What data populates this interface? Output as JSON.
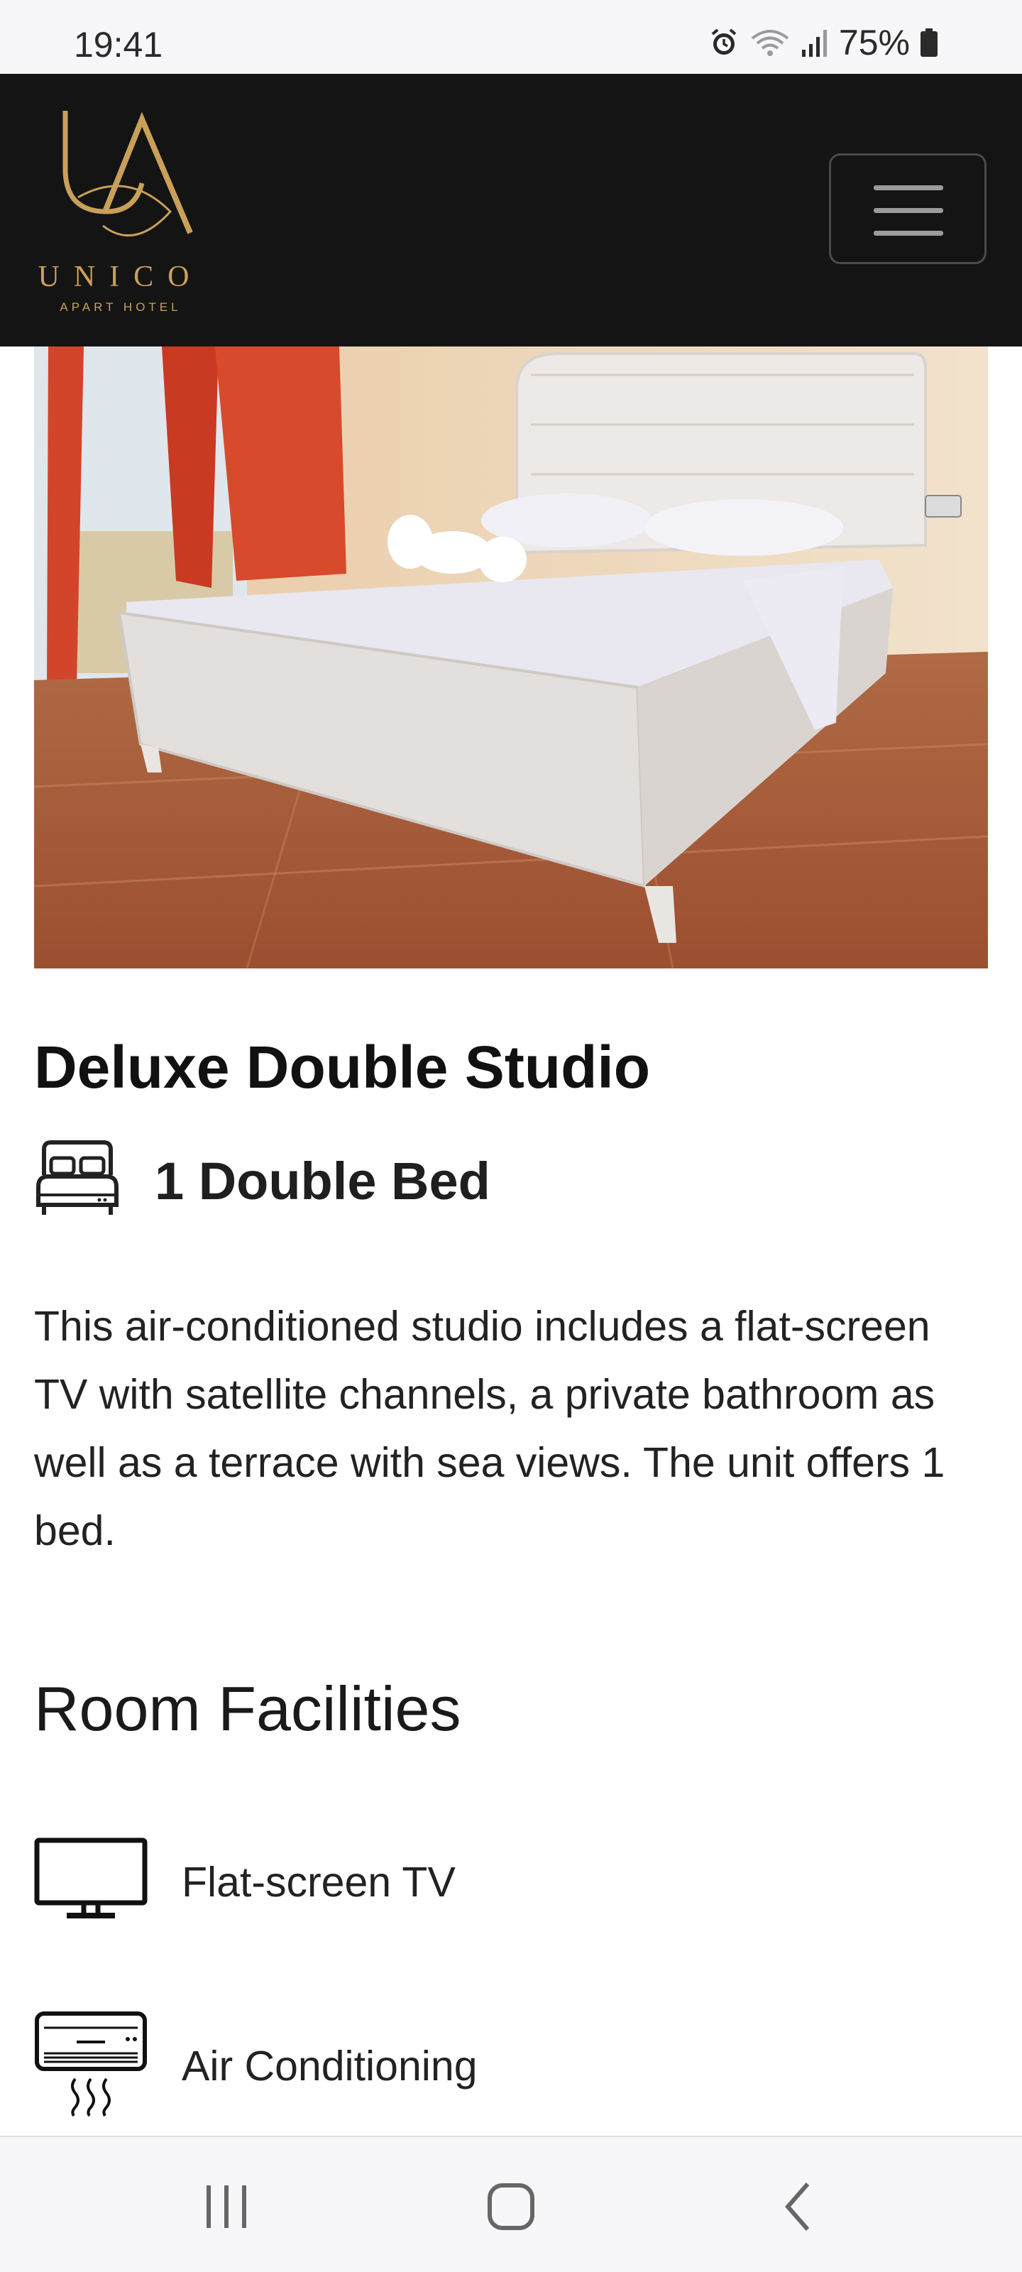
{
  "status_bar": {
    "time": "19:41",
    "battery_percent": "75%",
    "icons": [
      "alarm-icon",
      "wifi-icon",
      "signal-icon",
      "battery-icon"
    ]
  },
  "header": {
    "logo": {
      "monogram": "UA",
      "name": "UNICO",
      "tagline": "APART HOTEL",
      "color": "#c9a05a"
    },
    "menu_icon": "hamburger-icon",
    "background": "#141414"
  },
  "room": {
    "title": "Deluxe Double Studio",
    "bed_icon": "bed-icon",
    "bed_label": "1 Double Bed",
    "description": "This air-conditioned studio includes a flat-screen TV with satellite channels, a private bathroom as well as a terrace with sea views. The unit offers 1 bed."
  },
  "facilities": {
    "heading": "Room Facilities",
    "items": [
      {
        "label": "Flat-screen TV",
        "icon": "tv-icon"
      },
      {
        "label": "Air Conditioning",
        "icon": "air-conditioner-icon"
      }
    ]
  },
  "nav_bar": {
    "buttons": [
      "recent-apps-icon",
      "home-icon",
      "back-icon"
    ]
  }
}
